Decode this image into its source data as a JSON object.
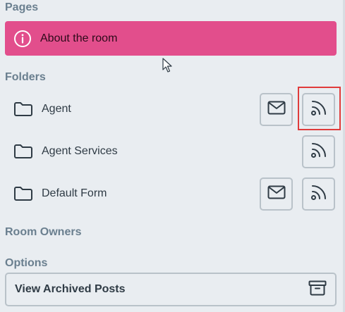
{
  "sections": {
    "pages": "Pages",
    "folders": "Folders",
    "room_owners": "Room Owners",
    "options": "Options"
  },
  "pages": [
    {
      "label": "About the room",
      "icon": "info-icon",
      "color": "#e24e8c"
    }
  ],
  "folders": [
    {
      "label": "Agent",
      "icon": "folder-icon",
      "has_mail": true,
      "has_rss": true
    },
    {
      "label": "Agent Services",
      "icon": "folder-icon",
      "has_mail": false,
      "has_rss": true
    },
    {
      "label": "Default Form",
      "icon": "folder-icon",
      "has_mail": true,
      "has_rss": true
    }
  ],
  "options": {
    "archived_label": "View Archived Posts",
    "archive_icon": "archive-icon"
  },
  "colors": {
    "background": "#e9edf1",
    "section_text": "#6a7f8f",
    "highlight": "#e03b3b"
  }
}
